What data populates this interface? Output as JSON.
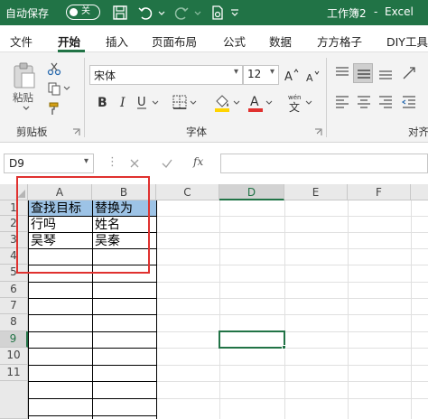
{
  "titlebar": {
    "autosave_label": "自动保存",
    "autosave_state": "关",
    "document_title": "工作簿2",
    "separator": "-",
    "app_name": "Excel"
  },
  "menu": {
    "tabs": [
      "文件",
      "开始",
      "插入",
      "页面布局",
      "公式",
      "数据",
      "方方格子",
      "DIY工具"
    ],
    "active_tab": "开始"
  },
  "ribbon": {
    "clipboard": {
      "paste_label": "粘贴",
      "group_label": "剪贴板"
    },
    "font": {
      "family": "宋体",
      "size": "12",
      "group_label": "字体",
      "font_color": "#e0312f",
      "fill_color": "#ffd400"
    },
    "alignment": {
      "group_label": "对齐"
    }
  },
  "formula_bar": {
    "name_box": "D9",
    "fx_label": "fx",
    "formula": ""
  },
  "grid": {
    "columns": [
      "A",
      "B",
      "C",
      "D",
      "E",
      "F"
    ],
    "selected_column": "D",
    "rows": [
      "1",
      "2",
      "3",
      "4",
      "5",
      "6",
      "7",
      "8",
      "9",
      "10",
      "11"
    ],
    "selected_row": "9",
    "cells": {
      "A1": "查找目标",
      "B1": "替换为",
      "A2": "行吗",
      "B2": "姓名",
      "A3": "吴琴",
      "B3": "吴秦"
    },
    "header_fill": "#9dc3e6",
    "highlight_box_color": "#e0312f"
  }
}
